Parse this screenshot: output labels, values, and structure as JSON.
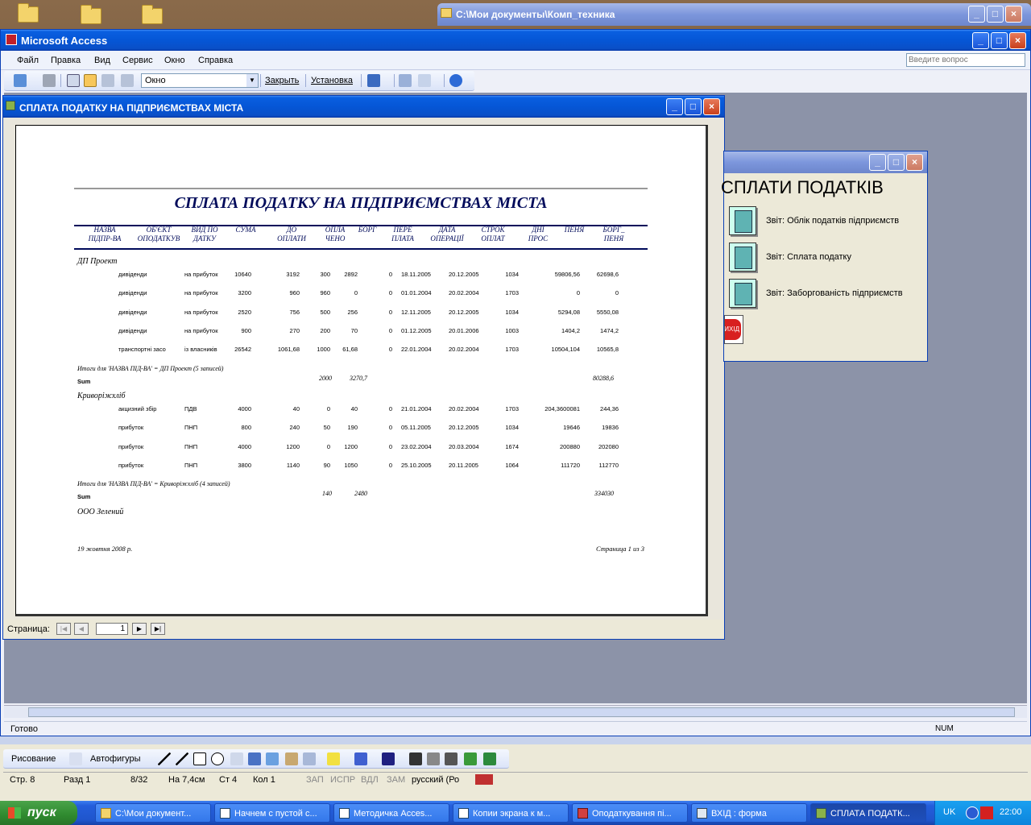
{
  "desktop": {
    "folder_window_title": "C:\\Мои документы\\Комп_техника"
  },
  "access": {
    "title": "Microsoft Access",
    "menu": [
      "Файл",
      "Правка",
      "Вид",
      "Сервис",
      "Окно",
      "Справка"
    ],
    "help_placeholder": "Введите вопрос",
    "toolbar": {
      "zoom_value": "Окно",
      "close_label": "Закрыть",
      "setup_label": "Установка"
    },
    "status": "Готово",
    "num_indicator": "NUM"
  },
  "report_window": {
    "title": "СПЛАТА ПОДАТКУ НА ПІДПРИЄМСТВАХ МІСТА",
    "report_title": "СПЛАТА ПОДАТКУ НА ПІДПРИЄМСТВАХ МІСТА",
    "headers": [
      {
        "l1": "НАЗВА",
        "l2": "ПІДПР-ВА"
      },
      {
        "l1": "ОБ'ЄКТ",
        "l2": "ОПОДАТКУВ"
      },
      {
        "l1": "ВИД ПО",
        "l2": "ДАТКУ"
      },
      {
        "l1": "СУМА",
        "l2": ""
      },
      {
        "l1": "ДО",
        "l2": "ОПЛАТИ"
      },
      {
        "l1": "ОПЛА",
        "l2": "ЧЕНО"
      },
      {
        "l1": "БОРГ",
        "l2": ""
      },
      {
        "l1": "ПЕРЕ",
        "l2": "ПЛАТА"
      },
      {
        "l1": "ДАТА",
        "l2": "ОПЕРАЦІЇ"
      },
      {
        "l1": "СТРОК",
        "l2": "ОПЛАТ"
      },
      {
        "l1": "ДНІ",
        "l2": "ПРОС"
      },
      {
        "l1": "ПЕНЯ",
        "l2": ""
      },
      {
        "l1": "БОРГ_",
        "l2": "ПЕНЯ"
      }
    ],
    "groups": [
      {
        "name": "ДП Проект",
        "rows": [
          [
            "дивіденди",
            "на прибуток",
            "10640",
            "3192",
            "300",
            "2892",
            "0",
            "18.11.2005",
            "20.12.2005",
            "1034",
            "59806,56",
            "62698,6"
          ],
          [
            "дивіденди",
            "на прибуток",
            "3200",
            "960",
            "960",
            "0",
            "0",
            "01.01.2004",
            "20.02.2004",
            "1703",
            "0",
            "0"
          ],
          [
            "дивіденди",
            "на прибуток",
            "2520",
            "756",
            "500",
            "256",
            "0",
            "12.11.2005",
            "20.12.2005",
            "1034",
            "5294,08",
            "5550,08"
          ],
          [
            "дивіденди",
            "на прибуток",
            "900",
            "270",
            "200",
            "70",
            "0",
            "01.12.2005",
            "20.01.2006",
            "1003",
            "1404,2",
            "1474,2"
          ],
          [
            "транспортні засо",
            "із власників",
            "26542",
            "1061,68",
            "1000",
            "61,68",
            "0",
            "22.01.2004",
            "20.02.2004",
            "1703",
            "10504,104",
            "10565,8"
          ]
        ],
        "summary": "Итоги для 'НАЗВА ПІД-ВА' = ДП Проект (5 записей)",
        "sum_label": "Sum",
        "sum_paid": "2000",
        "sum_debt": "3270,7",
        "sum_total": "80288,6"
      },
      {
        "name": "Криворіжхліб",
        "rows": [
          [
            "акцизний збір",
            "ПДВ",
            "4000",
            "40",
            "0",
            "40",
            "0",
            "21.01.2004",
            "20.02.2004",
            "1703",
            "204,3600081",
            "244,36"
          ],
          [
            "прибуток",
            "ПНП",
            "800",
            "240",
            "50",
            "190",
            "0",
            "05.11.2005",
            "20.12.2005",
            "1034",
            "19646",
            "19836"
          ],
          [
            "прибуток",
            "ПНП",
            "4000",
            "1200",
            "0",
            "1200",
            "0",
            "23.02.2004",
            "20.03.2004",
            "1674",
            "200880",
            "202080"
          ],
          [
            "прибуток",
            "ПНП",
            "3800",
            "1140",
            "90",
            "1050",
            "0",
            "25.10.2005",
            "20.11.2005",
            "1064",
            "111720",
            "112770"
          ]
        ],
        "summary": "Итоги для 'НАЗВА ПІД-ВА' = Криворіжхліб (4 записей)",
        "sum_label": "Sum",
        "sum_paid": "140",
        "sum_debt": "2480",
        "sum_total": "334030"
      }
    ],
    "next_group": "ООО Зелений",
    "footer_date": "19 жовтня 2008 р.",
    "footer_page": "Страница 1 из 3",
    "nav_label": "Страница:",
    "nav_page": "1"
  },
  "form_window": {
    "heading": "СПЛАТИ ПОДАТКІВ",
    "buttons": [
      "Звіт: Облік податків підприємств",
      "Звіт: Сплата податку",
      "Звіт: Заборгованість підприємств"
    ],
    "exit_label": "ВИХІД"
  },
  "word": {
    "draw_label": "Рисование",
    "autoshapes_label": "Автофигуры",
    "status": [
      "Стр. 8",
      "Разд 1",
      "8/32",
      "На 7,4см",
      "Ст 4",
      "Кол 1",
      "ЗАП",
      "ИСПР",
      "ВДЛ",
      "ЗАМ",
      "русский (Ро"
    ]
  },
  "taskbar": {
    "start": "пуск",
    "tasks": [
      "C:\\Мои документ...",
      "Начнем с пустой с...",
      "Методичка Acces...",
      "Копии экрана к м...",
      "Оподаткування пі...",
      "ВХІД : форма",
      "СПЛАТА ПОДАТК..."
    ],
    "lang": "UK",
    "clock": "22:00"
  }
}
